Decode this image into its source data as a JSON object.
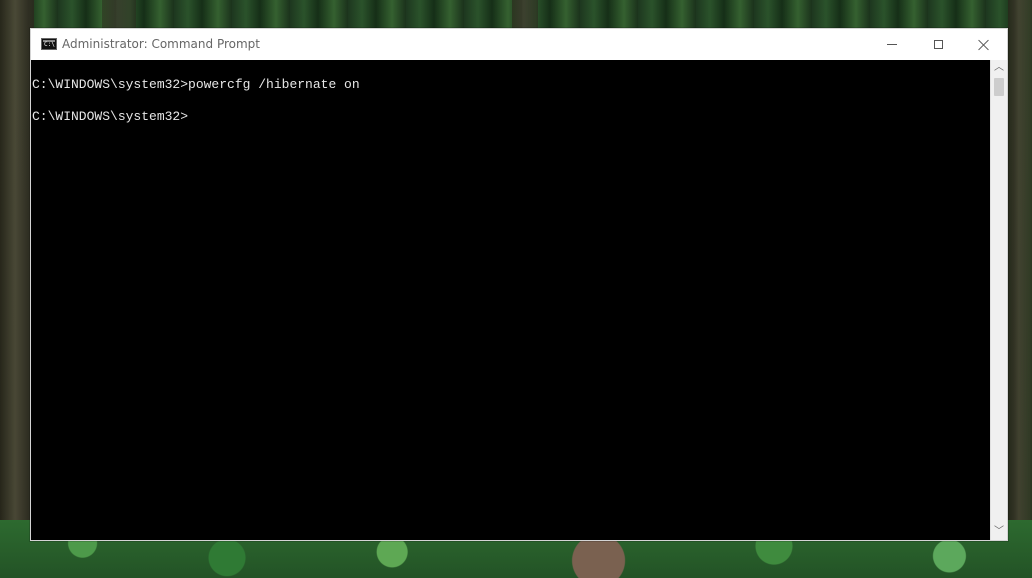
{
  "window": {
    "title": "Administrator: Command Prompt"
  },
  "icons": {
    "app": "command-prompt-icon",
    "minimize": "minimize-icon",
    "maximize": "maximize-icon",
    "close": "close-icon",
    "scroll_up": "chevron-up-icon",
    "scroll_down": "chevron-down-icon"
  },
  "console": {
    "lines": [
      "C:\\WINDOWS\\system32>powercfg /hibernate on",
      "C:\\WINDOWS\\system32>"
    ]
  },
  "colors": {
    "titlebar_bg": "#ffffff",
    "console_bg": "#000000",
    "console_text": "#e6e6e6",
    "scrollbar_bg": "#f0f0f0"
  }
}
